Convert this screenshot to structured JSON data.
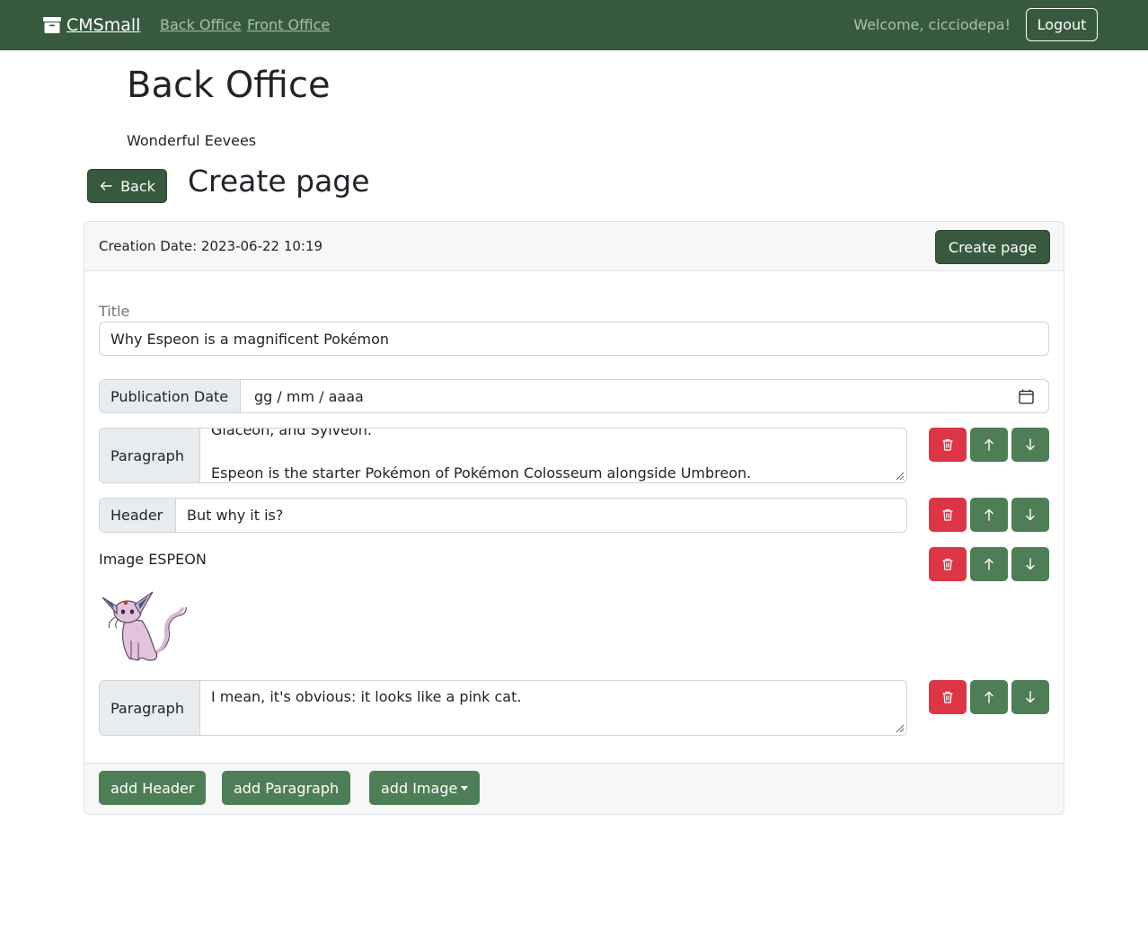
{
  "navbar": {
    "brand": "CMSmall",
    "links": [
      "Back Office",
      "Front Office"
    ],
    "welcome": "Welcome, cicciodepa!",
    "logout": "Logout"
  },
  "page": {
    "heading": "Back Office",
    "site_name": "Wonderful Eevees",
    "back_label": "Back",
    "form_heading": "Create page"
  },
  "card": {
    "creation_date": "Creation Date: 2023-06-22 10:19",
    "create_button": "Create page",
    "title_label": "Title",
    "title_value": "Why Espeon is a magnificent Pokémon",
    "pubdate_label": "Publication Date",
    "pubdate_placeholder": "gg / mm / aaaa",
    "blocks": [
      {
        "type": "Paragraph",
        "line1": "Glaceon, and Sylveon.",
        "line2": "",
        "line3": "Espeon is the starter Pokémon of Pokémon Colosseum alongside Umbreon."
      },
      {
        "type": "Header",
        "value": "But why it is?"
      },
      {
        "type": "Image",
        "label": "Image ESPEON"
      },
      {
        "type": "Paragraph",
        "line1": "I mean, it's obvious: it looks like a pink cat."
      }
    ],
    "footer": {
      "add_header": "add Header",
      "add_paragraph": "add Paragraph",
      "add_image": "add Image"
    }
  },
  "colors": {
    "navbar": "#375a3e",
    "button_green": "#4e7e55",
    "button_red": "#dc3545"
  },
  "icons": [
    "archive-icon",
    "arrow-left-icon",
    "calendar-icon",
    "trash-icon",
    "arrow-up-icon",
    "arrow-down-icon",
    "caret-down-icon"
  ]
}
